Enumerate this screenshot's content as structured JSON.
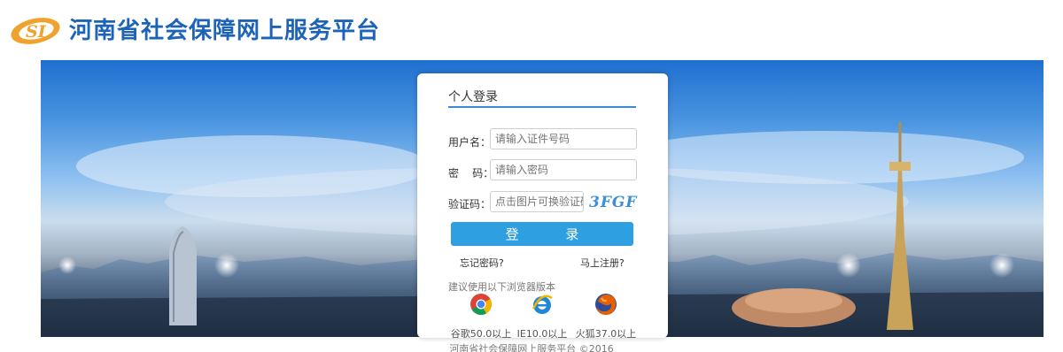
{
  "header": {
    "logo_text": "SI",
    "title": "河南省社会保障网上服务平台"
  },
  "login": {
    "tab_label": "个人登录",
    "username": {
      "label": "用户名：",
      "placeholder": "请输入证件号码"
    },
    "password": {
      "label": "密    码：",
      "placeholder": "请输入密码"
    },
    "captcha": {
      "label": "验证码：",
      "placeholder": "点击图片可换验证码",
      "image_text": "3FGF"
    },
    "login_button": "登 录",
    "forgot_password": "忘记密码?",
    "register": "马上注册?"
  },
  "browsers": {
    "hint": "建议使用以下浏览器版本",
    "items": [
      {
        "icon": "chrome-icon",
        "label": "谷歌50.0以上"
      },
      {
        "icon": "ie-icon",
        "label": "IE10.0以上"
      },
      {
        "icon": "firefox-icon",
        "label": "火狐37.0以上"
      }
    ]
  },
  "footer": {
    "text": "河南省社会保障网上服务平台 ©2016"
  },
  "colors": {
    "brand_blue": "#1d63b8",
    "logo_orange": "#f0a22e",
    "button_blue": "#2e9fe0"
  }
}
